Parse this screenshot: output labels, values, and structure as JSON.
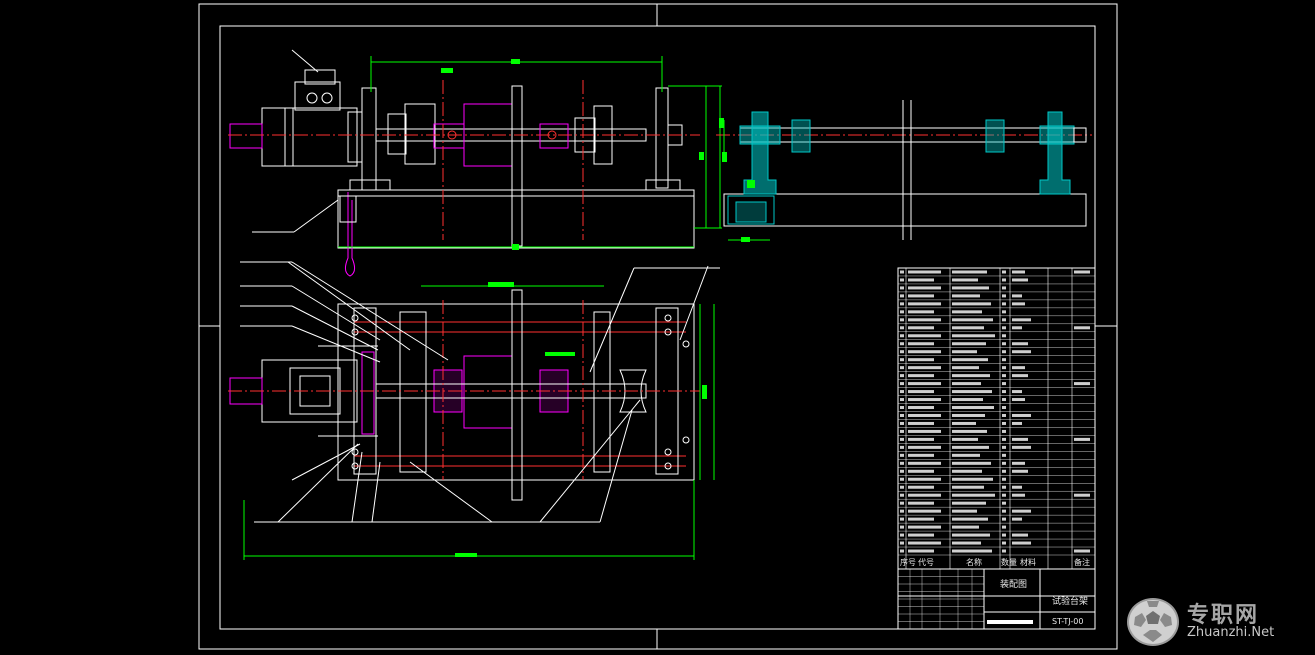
{
  "colors": {
    "background": "#000000",
    "frame": "#ffffff",
    "part_outline": "#ffffff",
    "centerline": "#ff3030",
    "dimension": "#00ff00",
    "coupling": "#ff00ff",
    "section_fill": "#00c8c8",
    "leader": "#ffffff"
  },
  "title_block": {
    "header": {
      "seq": "序号",
      "code": "代号",
      "name": "名称",
      "qty": "数量",
      "material": "材料",
      "remark": "备注"
    },
    "drawing_type": "装配图",
    "drawing_title": "试验台架",
    "drawing_number": "ST-TJ-00"
  },
  "parts_list_rows": 36,
  "watermark": {
    "cn": "专职网",
    "en": "Zhuanzhi.Net",
    "icon": "soccer-ball-icon"
  }
}
